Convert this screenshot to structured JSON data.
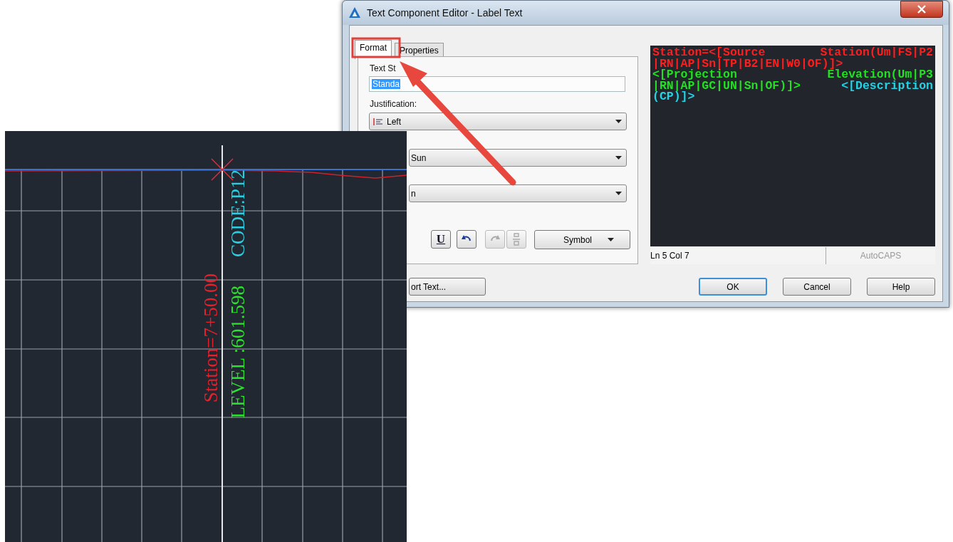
{
  "dialog": {
    "title": "Text Component Editor - Label Text",
    "tabs": [
      {
        "label": "Format",
        "selected": true
      },
      {
        "label": "Properties",
        "selected": false
      }
    ],
    "text_style": {
      "label": "Text St",
      "value": "Standa",
      "selected_text": true
    },
    "justification": {
      "label": "Justification:",
      "value": "Left"
    },
    "font": {
      "value": "Sun"
    },
    "dropdown_3": {
      "value": "n"
    },
    "toolbar": [
      {
        "kind": "underline",
        "label": "U",
        "disabled": false
      },
      {
        "kind": "undo",
        "disabled": false
      },
      {
        "kind": "redo",
        "disabled": true
      },
      {
        "kind": "stack",
        "disabled": true
      }
    ],
    "symbol_button": "Symbol",
    "editor": {
      "lines": [
        {
          "segments": [
            {
              "text": "Station=<[Source",
              "color": "#ff1e1e"
            },
            {
              "text": "Station(Um|FS|P2",
              "color": "#ff1e1e"
            }
          ]
        },
        {
          "segments": [
            {
              "text": "|RN|AP|Sn|TP|B2|EN|W0|OF)]>",
              "color": "#ff1e1e"
            }
          ]
        },
        {
          "segments": [
            {
              "text": "<[Projection",
              "color": "#22e022"
            },
            {
              "text": "Elevation(Um|P3",
              "color": "#22e022"
            }
          ]
        },
        {
          "segments": [
            {
              "text": "|RN|AP|GC|UN|Sn|OF)]>",
              "color": "#22e022"
            },
            {
              "text": "<[Description",
              "color": "#22d4e6"
            }
          ]
        },
        {
          "segments": [
            {
              "text": "(CP)]>",
              "color": "#22d4e6"
            }
          ]
        }
      ]
    },
    "status": {
      "position": "Ln 5 Col 7",
      "caps": "AutoCAPS",
      "caps_on": false
    },
    "import_button": "ort Text...",
    "buttons": [
      {
        "label": "OK",
        "default": true
      },
      {
        "label": "Cancel",
        "default": false
      },
      {
        "label": "Help",
        "default": false
      }
    ]
  },
  "drawing": {
    "labels": [
      {
        "text": "Station=7+50.00",
        "color": "#e8202a"
      },
      {
        "text": "LEVEL :601.598",
        "color": "#2ee02e"
      },
      {
        "text": "CODE:P12",
        "color": "#28cfe0"
      }
    ]
  }
}
